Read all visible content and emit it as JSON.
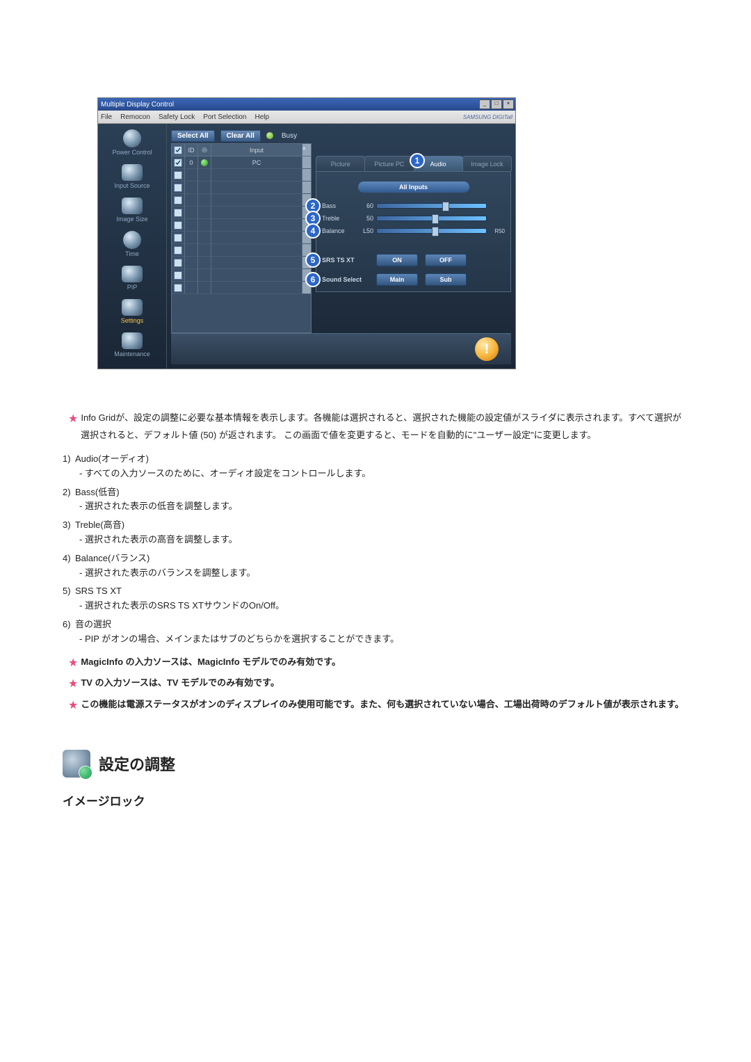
{
  "window": {
    "title": "Multiple Display Control",
    "brand": "SAMSUNG DIGITall"
  },
  "menubar": [
    "File",
    "Remocon",
    "Safety Lock",
    "Port Selection",
    "Help"
  ],
  "sidebar": [
    {
      "label": "Power Control"
    },
    {
      "label": "Input Source"
    },
    {
      "label": "Image Size"
    },
    {
      "label": "Time"
    },
    {
      "label": "PIP"
    },
    {
      "label": "Settings",
      "selected": true
    },
    {
      "label": "Maintenance"
    }
  ],
  "toolbar": {
    "select_all": "Select All",
    "clear_all": "Clear All",
    "busy": "Busy"
  },
  "grid": {
    "headers": {
      "id": "ID",
      "input": "Input"
    },
    "row": {
      "id": "0",
      "input": "PC"
    },
    "empty_rows": 10
  },
  "tabs": [
    "Picture",
    "Picture PC",
    "Audio",
    "Image Lock"
  ],
  "active_tab_index": 2,
  "badge_main": "1",
  "inputs_pill": "All Inputs",
  "sliders": [
    {
      "num": "2",
      "label": "Bass",
      "val": "60",
      "right": "",
      "pos": 60
    },
    {
      "num": "3",
      "label": "Treble",
      "val": "50",
      "right": "",
      "pos": 50
    },
    {
      "num": "4",
      "label": "Balance",
      "val": "L50",
      "right": "R50",
      "pos": 50
    }
  ],
  "button_rows": [
    {
      "num": "5",
      "label": "SRS TS XT",
      "options": [
        "ON",
        "OFF"
      ]
    },
    {
      "num": "6",
      "label": "Sound Select",
      "options": [
        "Main",
        "Sub"
      ]
    }
  ],
  "notes_top": [
    "Info Gridが、設定の調整に必要な基本情報を表示します。各機能は選択されると、選択された機能の設定値がスライダに表示されます。すべて選択が選択されると、デフォルト値 (50) が返されます。\nこの画面で値を変更すると、モードを自動的に\"ユーザー設定\"に変更します。"
  ],
  "numbered": [
    {
      "n": "1)",
      "title": "Audio(オーディオ)",
      "desc": "- すべての入力ソースのために、オーディオ設定をコントロールします。"
    },
    {
      "n": "2)",
      "title": "Bass(低音)",
      "desc": "- 選択された表示の低音を調整します。"
    },
    {
      "n": "3)",
      "title": "Treble(高音)",
      "desc": "- 選択された表示の高音を調整します。"
    },
    {
      "n": "4)",
      "title": "Balance(バランス)",
      "desc": "- 選択された表示のバランスを調整します。"
    },
    {
      "n": "5)",
      "title": "SRS TS XT",
      "desc": "- 選択された表示のSRS TS XTサウンドのOn/Off。"
    },
    {
      "n": "6)",
      "title": "音の選択",
      "desc": "- PIP がオンの場合、メインまたはサブのどちらかを選択することができます。"
    }
  ],
  "notes_bottom": [
    "MagicInfo の入力ソースは、MagicInfo モデルでのみ有効です。",
    "TV の入力ソースは、TV モデルでのみ有効です。",
    "この機能は電源ステータスがオンのディスプレイのみ使用可能です。また、何も選択されていない場合、工場出荷時のデフォルト値が表示されます。"
  ],
  "section": {
    "title": "設定の調整",
    "sub": "イメージロック"
  }
}
